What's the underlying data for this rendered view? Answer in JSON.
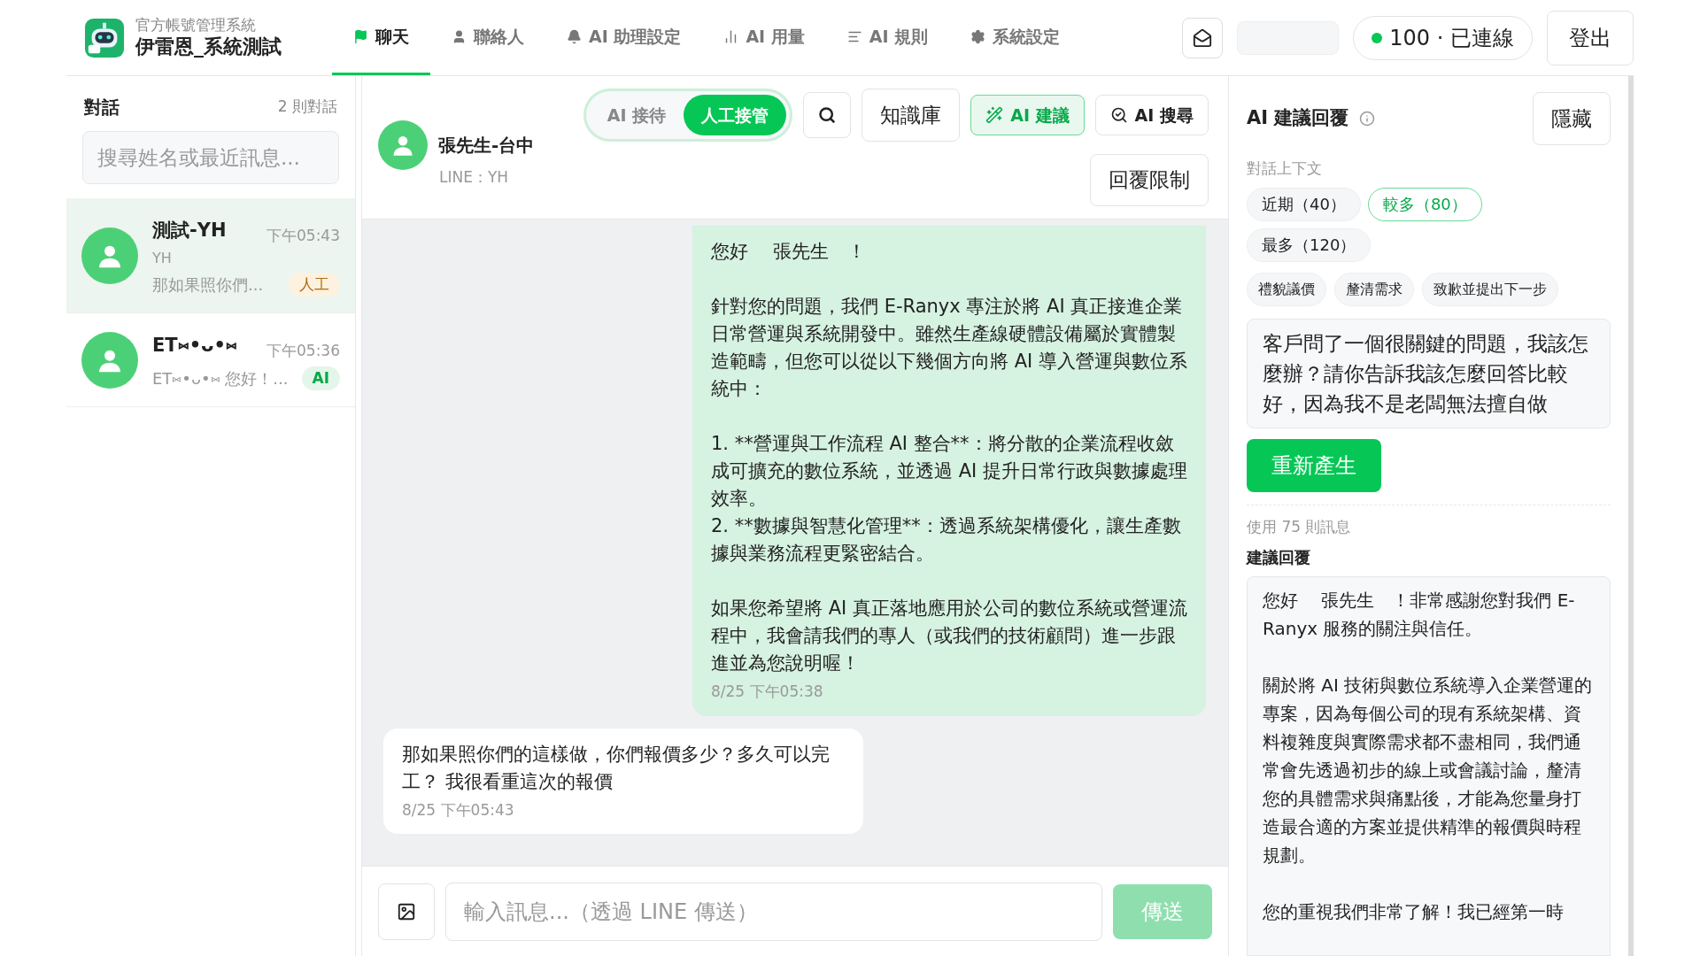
{
  "app": {
    "subtitle": "官方帳號管理系統",
    "title": "伊雷恩_系統測試"
  },
  "nav": [
    {
      "label": "聊天",
      "selected": true
    },
    {
      "label": "聯絡人",
      "selected": false
    },
    {
      "label": "AI 助理設定",
      "selected": false
    },
    {
      "label": "AI 用量",
      "selected": false
    },
    {
      "label": "AI 規則",
      "selected": false
    },
    {
      "label": "系統設定",
      "selected": false
    }
  ],
  "header_right": {
    "status": "100 · 已連線",
    "connected": true,
    "logout": "登出"
  },
  "sidebar": {
    "title": "對話",
    "count": "2 則對話",
    "search": {
      "placeholder": "搜尋姓名或最近訊息..."
    },
    "conversations": [
      {
        "name": "測試-YH",
        "sub": "YH",
        "preview": "那如果照你們...",
        "time": "下午05:43",
        "badge": {
          "label": "人工",
          "kind": "human"
        },
        "selected": true
      },
      {
        "name": "ET⑅•ᴗ•⑅",
        "preview": "ET⑅•ᴗ•⑅ 您好！...",
        "time": "下午05:36",
        "badge": {
          "label": "AI",
          "kind": "ai"
        },
        "selected": false
      }
    ]
  },
  "chat": {
    "contact": {
      "name": "張先生-台中",
      "channel": "LINE：YH"
    },
    "mode": [
      {
        "label": "AI 接待",
        "selected": false
      },
      {
        "label": "人工接管",
        "selected": true
      }
    ],
    "tools": [
      {
        "label": "知識庫",
        "kind": "plain",
        "active": false
      },
      {
        "label": "AI 建議",
        "kind": "suggest",
        "active": true
      },
      {
        "label": "AI 搜尋",
        "kind": "search",
        "active": false
      }
    ],
    "reply_limit": "回覆限制",
    "messages": [
      {
        "kind": "outgoing",
        "blocks": [
          [
            "您好　 張先生　！"
          ],
          [
            "針對您的問題，我們 E-Ranyx 專注於將 AI 真正接進企業日常營運與系統開發中。雖然生產線硬體設備屬於實體製造範疇，但您可以從以下幾個方向將 AI 導入營運與數位系統中："
          ],
          [
            "1. **營運與工作流程 AI 整合**：將分散的企業流程收斂成可擴充的數位系統，並透過 AI 提升日常行政與數據處理效率。",
            "2. **數據與智慧化管理**：透過系統架構優化，讓生產數據與業務流程更緊密結合。"
          ],
          [
            "如果您希望將 AI 真正落地應用於公司的數位系統或營運流程中，我會請我們的專人（或我們的技術顧問）進一步跟進並為您說明喔！"
          ]
        ],
        "time": "8/25 下午05:38"
      },
      {
        "kind": "incoming",
        "blocks": [
          [
            "那如果照你們的這樣做，你們報價多少？多久可以完工？ 我很看重這次的報價"
          ]
        ],
        "time": "8/25 下午05:43"
      }
    ],
    "composer": {
      "placeholder": "輸入訊息...（透過 LINE 傳送）",
      "send": "傳送",
      "send_disabled": true
    }
  },
  "suggest": {
    "title": "AI 建議回覆",
    "hide": "隱藏",
    "context_label": "對話上下文",
    "context": [
      {
        "label": "近期（40）",
        "selected": false
      },
      {
        "label": "較多（80）",
        "selected": true
      },
      {
        "label": "最多（120）",
        "selected": false
      }
    ],
    "quick": [
      "禮貌議價",
      "釐清需求",
      "致歉並提出下一步"
    ],
    "prompt": "客戶問了一個很關鍵的問題，我該怎麼辦？請你告訴我該怎麼回答比較好，因為我不是老闆無法擅自做",
    "regenerate": "重新產生",
    "used": "使用 75 則訊息",
    "reply_label": "建議回覆",
    "reply": [
      "您好　 張先生　！非常感謝您對我們 E-Ranyx 服務的關注與信任。",
      "關於將 AI 技術與數位系統導入企業營運的專案，因為每個公司的現有系統架構、資料複雜度與實際需求都不盡相同，我們通常會先透過初步的線上或會議討論，釐清您的具體需求與痛點後，才能為您量身打造最合適的方案並提供精準的報價與時程規劃。",
      "您的重視我們非常了解！我已經第一時"
    ]
  }
}
